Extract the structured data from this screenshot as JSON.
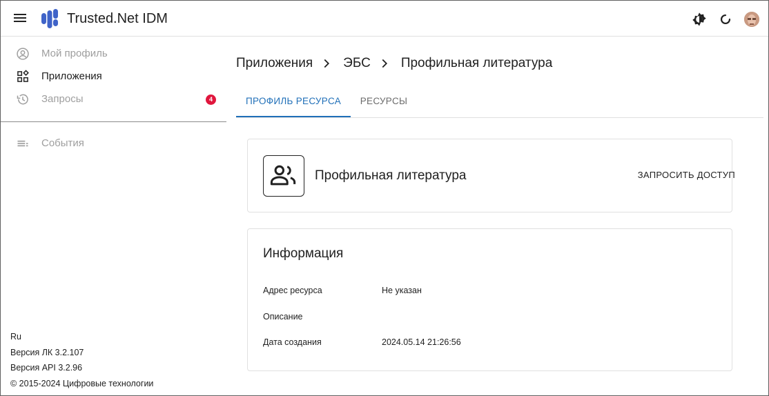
{
  "header": {
    "app_title": "Trusted.Net IDM",
    "icons": [
      "menu-icon",
      "app-logo",
      "theme-toggle-icon",
      "refresh-icon",
      "avatar"
    ]
  },
  "sidebar": {
    "items": [
      {
        "label": "Мой профиль",
        "icon": "account-circle-icon",
        "state": "muted"
      },
      {
        "label": "Приложения",
        "icon": "apps-grid-icon",
        "state": "active"
      },
      {
        "label": "Запросы",
        "icon": "history-icon",
        "state": "muted",
        "badge": "4"
      },
      {
        "label": "События",
        "icon": "list-icon",
        "state": "muted"
      }
    ],
    "footer": {
      "lang": "Ru",
      "version_lk": "Версия ЛК 3.2.107",
      "version_api": "Версия API 3.2.96",
      "copyright": "© 2015-2024 Цифровые технологии"
    }
  },
  "main": {
    "breadcrumb": [
      "Приложения",
      "ЭБС",
      "Профильная литература"
    ],
    "tabs": [
      {
        "label": "ПРОФИЛЬ РЕСУРСА",
        "active": true
      },
      {
        "label": "РЕСУРСЫ",
        "active": false
      }
    ],
    "resource": {
      "title": "Профильная литература",
      "request_button": "ЗАПРОСИТЬ ДОСТУП",
      "icon": "group-icon"
    },
    "info": {
      "title": "Информация",
      "rows": [
        {
          "label": "Адрес ресурса",
          "value": "Не указан"
        },
        {
          "label": "Описание",
          "value": ""
        },
        {
          "label": "Дата создания",
          "value": "2024.05.14 21:26:56"
        }
      ]
    }
  },
  "colors": {
    "accent": "#1f6fb8",
    "badge": "#e0163d",
    "logo": "#3f63c8"
  }
}
